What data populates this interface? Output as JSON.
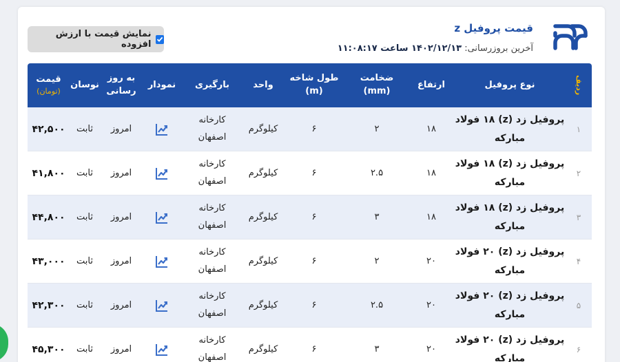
{
  "header": {
    "title": "قیمت پروفیل z",
    "update_label": "آخرین بروزرسانی:",
    "update_value": "۱۴۰۲/۱۲/۱۳ ساعت ۱۱:۰۸:۱۷"
  },
  "vat_toggle": {
    "label": "نمایش قیمت با ارزش افزوده",
    "checked": true
  },
  "colors": {
    "primary": "#1f4fa5",
    "accent": "#f0b400",
    "row_alt": "#e9eef8"
  },
  "table": {
    "columns": {
      "radif": "ردیف",
      "name": "نوع پروفیل",
      "height": "ارتفاع",
      "thickness": "ضخامت",
      "thickness_unit": "(mm)",
      "length": "طول شاخه",
      "length_unit": "(m)",
      "unit": "واحد",
      "loading": "بارگیری",
      "chart": "نمودار",
      "updated_1": "به روز",
      "updated_2": "رسانی",
      "fluct": "نوسان",
      "price": "قیمت",
      "price_unit": "(تومان)"
    },
    "rows": [
      {
        "idx": "۱",
        "name_1": "پروفیل زد (z) ۱۸ فولاد",
        "name_2": "مبارکه",
        "height": "۱۸",
        "thickness": "۲",
        "length": "۶",
        "unit": "کیلوگرم",
        "loading_1": "کارخانه",
        "loading_2": "اصفهان",
        "chart_icon": "chart-line-icon",
        "updated": "امروز",
        "fluct": "ثابت",
        "price": "۴۲,۵۰۰"
      },
      {
        "idx": "۲",
        "name_1": "پروفیل زد (z) ۱۸ فولاد",
        "name_2": "مبارکه",
        "height": "۱۸",
        "thickness": "۲.۵",
        "length": "۶",
        "unit": "کیلوگرم",
        "loading_1": "کارخانه",
        "loading_2": "اصفهان",
        "chart_icon": "chart-line-icon",
        "updated": "امروز",
        "fluct": "ثابت",
        "price": "۴۱,۸۰۰"
      },
      {
        "idx": "۳",
        "name_1": "پروفیل زد (z) ۱۸ فولاد",
        "name_2": "مبارکه",
        "height": "۱۸",
        "thickness": "۳",
        "length": "۶",
        "unit": "کیلوگرم",
        "loading_1": "کارخانه",
        "loading_2": "اصفهان",
        "chart_icon": "chart-line-icon",
        "updated": "امروز",
        "fluct": "ثابت",
        "price": "۴۴,۸۰۰"
      },
      {
        "idx": "۴",
        "name_1": "پروفیل زد (z) ۲۰ فولاد",
        "name_2": "مبارکه",
        "height": "۲۰",
        "thickness": "۲",
        "length": "۶",
        "unit": "کیلوگرم",
        "loading_1": "کارخانه",
        "loading_2": "اصفهان",
        "chart_icon": "chart-line-icon",
        "updated": "امروز",
        "fluct": "ثابت",
        "price": "۴۳,۰۰۰"
      },
      {
        "idx": "۵",
        "name_1": "پروفیل زد (z) ۲۰ فولاد",
        "name_2": "مبارکه",
        "height": "۲۰",
        "thickness": "۲.۵",
        "length": "۶",
        "unit": "کیلوگرم",
        "loading_1": "کارخانه",
        "loading_2": "اصفهان",
        "chart_icon": "chart-line-icon",
        "updated": "امروز",
        "fluct": "ثابت",
        "price": "۴۲,۳۰۰"
      },
      {
        "idx": "۶",
        "name_1": "پروفیل زد (z) ۲۰ فولاد",
        "name_2": "مبارکه",
        "height": "۲۰",
        "thickness": "۳",
        "length": "۶",
        "unit": "کیلوگرم",
        "loading_1": "کارخانه",
        "loading_2": "اصفهان",
        "chart_icon": "chart-line-icon",
        "updated": "امروز",
        "fluct": "ثابت",
        "price": "۴۵,۳۰۰"
      }
    ]
  }
}
